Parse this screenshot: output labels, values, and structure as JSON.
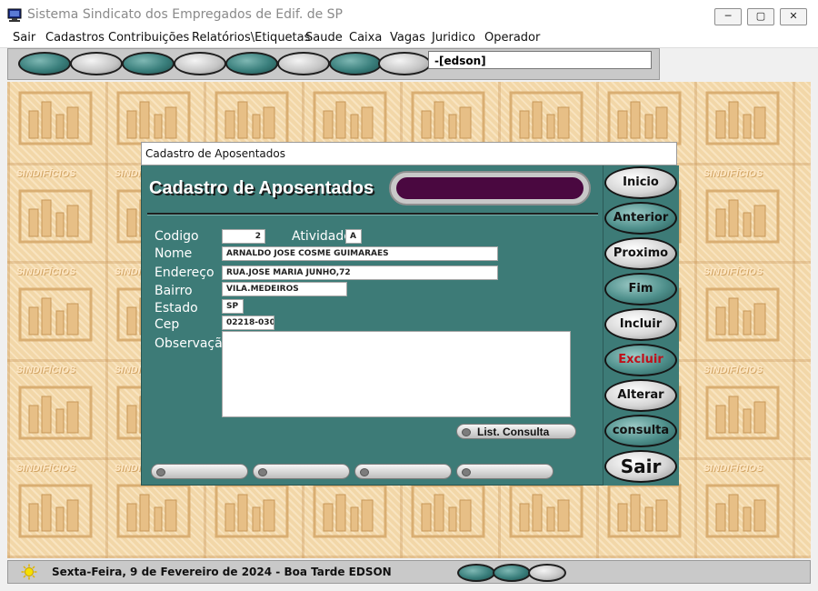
{
  "window": {
    "title": "Sistema Sindicato dos Empregados de Edif. de SP",
    "controls": {
      "minimize": "─",
      "maximize": "▢",
      "close": "✕"
    }
  },
  "menu": [
    "Sair",
    "Cadastros",
    "Contribuições",
    "Relatórios\\Etiquetas",
    "Saude",
    "Caixa",
    "Vagas",
    "Juridico",
    "Operador"
  ],
  "toolbar": {
    "user_field": "-[edson]",
    "oval_colors": [
      "teal",
      "gray",
      "teal",
      "gray",
      "teal",
      "gray",
      "teal",
      "gray"
    ]
  },
  "background": {
    "tile_text": "SINDIFÍCIOS"
  },
  "form": {
    "window_title": "Cadastro de Aposentados",
    "heading": "Cadastro de Aposentados",
    "fields": {
      "codigo": {
        "label": "Codigo",
        "value": "2"
      },
      "atividade": {
        "label": "Atividade",
        "value": "A"
      },
      "nome": {
        "label": "Nome",
        "value": "ARNALDO JOSE COSME GUIMARAES"
      },
      "endereco": {
        "label": "Endereço",
        "value": "RUA.JOSE MARIA JUNHO,72"
      },
      "bairro": {
        "label": "Bairro",
        "value": "VILA.MEDEIROS"
      },
      "estado": {
        "label": "Estado",
        "value": "SP"
      },
      "cep": {
        "label": "Cep",
        "value": "02218-030"
      },
      "observacao": {
        "label": "Observação",
        "value": ""
      }
    },
    "list_button": "List. Consulta",
    "bottom_buttons": [
      "",
      "",
      "",
      ""
    ]
  },
  "nav_buttons": [
    {
      "label": "Inicio",
      "style": "gray",
      "color": "#111111"
    },
    {
      "label": "Anterior",
      "style": "teal",
      "color": "#111111"
    },
    {
      "label": "Proximo",
      "style": "gray",
      "color": "#111111"
    },
    {
      "label": "Fim",
      "style": "teal",
      "color": "#111111"
    },
    {
      "label": "Incluir",
      "style": "gray",
      "color": "#111111"
    },
    {
      "label": "Excluir",
      "style": "teal",
      "color": "#c0101a"
    },
    {
      "label": "Alterar",
      "style": "gray",
      "color": "#111111"
    },
    {
      "label": "consulta",
      "style": "teal",
      "color": "#111111"
    },
    {
      "label": "Sair",
      "style": "gray",
      "color": "#111111"
    }
  ],
  "status": {
    "text": "Sexta-Feira,  9 de Fevereiro de 2024 - Boa Tarde  EDSON",
    "oval_colors": [
      "teal",
      "teal",
      "gray"
    ]
  },
  "colors": {
    "form_bg": "#3d7b77",
    "heading_pill": "#4a0840",
    "desktop_bg": "#f2d7a8",
    "excluir_text": "#c0101a"
  }
}
